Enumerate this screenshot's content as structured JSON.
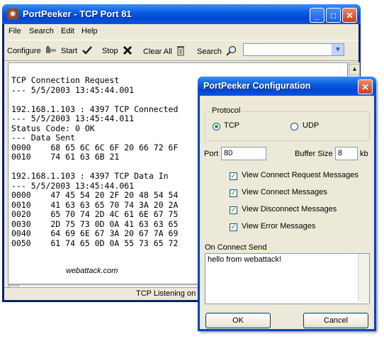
{
  "main_window": {
    "title": "PortPeeker - TCP Port 81",
    "title_buttons": {
      "minimize": "_",
      "maximize": "□",
      "close": "✕"
    },
    "menu": [
      "File",
      "Search",
      "Edit",
      "Help"
    ],
    "toolbar": {
      "configure": "Configure",
      "start": "Start",
      "stop": "Stop",
      "clear_all": "Clear All",
      "search": "Search"
    },
    "search_value": "",
    "log_lines": [
      "TCP Connection Request",
      "--- 5/5/2003 13:45:44.001",
      "",
      "192.168.1.103 : 4397 TCP Connected",
      "--- 5/5/2003 13:45:44.011",
      "Status Code: 0 OK",
      "--- Data Sent",
      "0000    68 65 6C 6C 6F 20 66 72 6F",
      "0010    74 61 63 6B 21",
      "",
      "192.168.1.103 : 4397 TCP Data In",
      "--- 5/5/2003 13:45:44.061",
      "0000    47 45 54 20 2F 20 48 54 54",
      "0010    41 63 63 65 70 74 3A 20 2A",
      "0020    65 70 74 2D 4C 61 6E 67 75",
      "0030    2D 75 73 0D 0A 41 63 63 65",
      "0040    64 69 6E 67 3A 20 67 7A 69",
      "0050    61 74 65 0D 0A 55 73 65 72"
    ],
    "watermark": "webattack.com",
    "status": "TCP Listening on P"
  },
  "dialog": {
    "title": "PortPeeker Configuration",
    "protocol_group": "Protocol",
    "protocol_options": [
      "TCP",
      "UDP"
    ],
    "protocol_selected": "TCP",
    "port_label": "Port",
    "port_value": "80",
    "buffer_label": "Buffer Size",
    "buffer_value": "8",
    "buffer_unit": "kb",
    "options": [
      {
        "label": "View Connect Request Messages",
        "checked": true
      },
      {
        "label": "View Connect Messages",
        "checked": true
      },
      {
        "label": "View Disconnect Messages",
        "checked": true
      },
      {
        "label": "View Error Messages",
        "checked": true
      }
    ],
    "on_connect_label": "On Connect Send",
    "on_connect_value": "hello from webattack!",
    "ok": "OK",
    "cancel": "Cancel"
  },
  "colors": {
    "titlebar": "#0a5fe0",
    "face": "#ece9d8",
    "close_button": "#c4401b"
  }
}
